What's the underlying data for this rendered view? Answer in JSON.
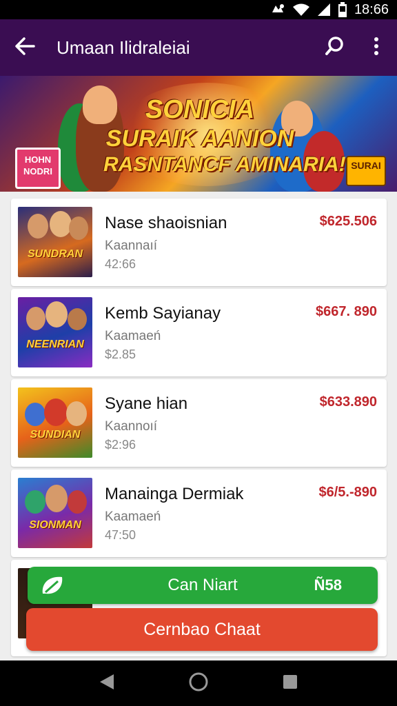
{
  "status_bar": {
    "time": "18:66",
    "icons": [
      "notification-icon",
      "wifi-icon",
      "signal-icon",
      "battery-icon"
    ]
  },
  "app_bar": {
    "title": "Umaan Ilidraleiai",
    "back_icon": "arrow-back-icon",
    "search_icon": "search-icon",
    "menu_icon": "more-vert-icon"
  },
  "banner": {
    "line1": "SONICIA",
    "line2": "SURAIK AANION",
    "line3": "RASNTANCF AMINARIA!",
    "badge_left": "HOHN\nNODRI",
    "badge_right": "SURAI"
  },
  "items": [
    {
      "name": "Nase shaoisnian",
      "subtitle": "Kaannaıí",
      "time": "42:66",
      "price": "$625.506",
      "art_text": "SUNDRAN"
    },
    {
      "name": "Kemb Sayianay",
      "subtitle": "Kaamaeń",
      "time": "$2.85",
      "price": "$667. 890",
      "art_text": "NEENRIAN"
    },
    {
      "name": "Syane hian",
      "subtitle": "Kaannoıí",
      "time": "$2:96",
      "price": "$633.890",
      "art_text": "SUNDIAN"
    },
    {
      "name": "Manainga Dermiak",
      "subtitle": "Kaamaeń",
      "time": "47:50",
      "price": "$6/5.-890",
      "art_text": "SIONMAN"
    }
  ],
  "buttons": {
    "primary_label": "Can Niart",
    "primary_count": "Ñ58",
    "secondary_label": "Cernbao Chaat"
  },
  "colors": {
    "app_bar": "#3a0d52",
    "price": "#c0262c",
    "green_button": "#27a83b",
    "red_button": "#e3492f"
  }
}
